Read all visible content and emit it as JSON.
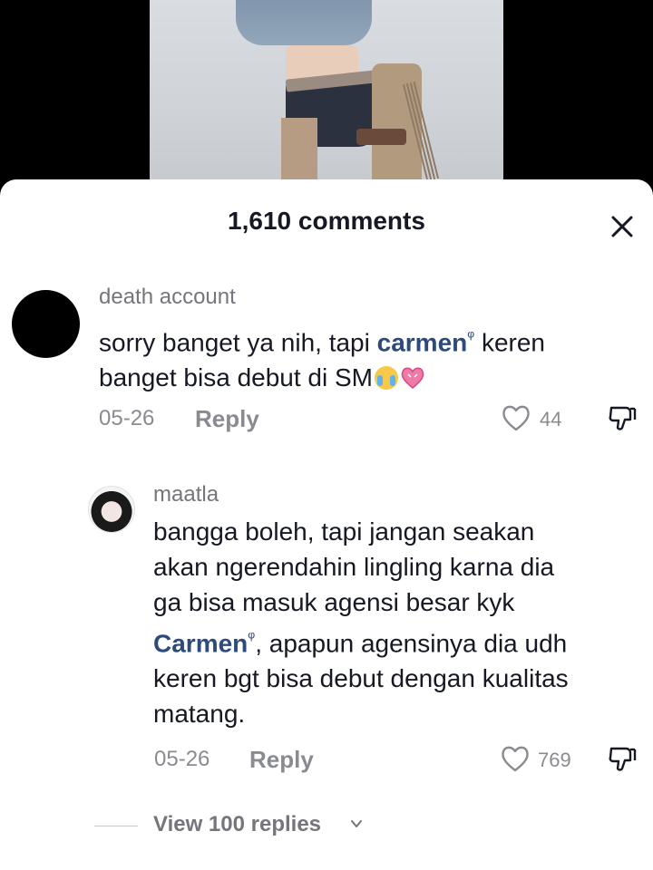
{
  "video": {
    "description_icon": "video-frame"
  },
  "sheet": {
    "title": "1,610 comments",
    "close_icon": "close-icon"
  },
  "comments": [
    {
      "username": "death account",
      "text_before": "sorry banget ya nih, tapi ",
      "mention": "carmen",
      "text_after_mention": " keren",
      "line2": "banget bisa debut di SM",
      "emojis": [
        "loudly-crying-face",
        "growing-heart"
      ],
      "date": "05-26",
      "reply_label": "Reply",
      "likes": "44"
    },
    {
      "username": "maatla",
      "lines": [
        "bangga boleh, tapi jangan seakan",
        "akan ngerendahin lingling karna dia",
        "ga bisa masuk agensi besar kyk"
      ],
      "mention": "Carmen",
      "text_after_mention": ", apapun agensinya dia udh",
      "line5": "keren bgt bisa debut dengan kualitas",
      "line6": "matang.",
      "date": "05-26",
      "reply_label": "Reply",
      "likes": "769"
    }
  ],
  "view_replies": {
    "label": "View 100 replies"
  },
  "colors": {
    "mention": "#2d4a7c",
    "text": "#161823",
    "muted": "#8a8b91"
  }
}
